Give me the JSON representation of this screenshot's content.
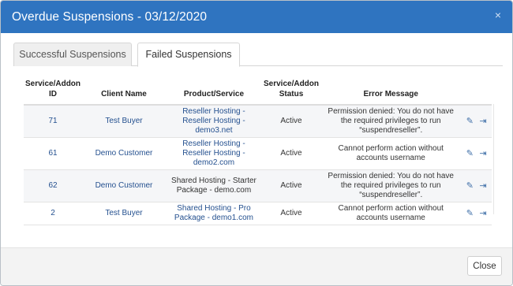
{
  "modal": {
    "title": "Overdue Suspensions - 03/12/2020",
    "close_icon": "×",
    "close_button_label": "Close"
  },
  "tabs": [
    {
      "label": "Successful Suspensions",
      "active": false
    },
    {
      "label": "Failed Suspensions",
      "active": true
    }
  ],
  "table": {
    "headers": {
      "id_line1": "Service/Addon",
      "id_line2": "ID",
      "client": "Client Name",
      "product": "Product/Service",
      "status_line1": "Service/Addon",
      "status_line2": "Status",
      "error": "Error Message"
    },
    "rows": [
      {
        "id": "71",
        "client": "Test Buyer",
        "product": "Reseller Hosting - Reseller Hosting - demo3.net",
        "status": "Active",
        "error": "Permission denied: You do not have the required privileges to run “suspendreseller”."
      },
      {
        "id": "61",
        "client": "Demo Customer",
        "product": "Reseller Hosting - Reseller Hosting - demo2.com",
        "status": "Active",
        "error": "Cannot perform action without accounts username"
      },
      {
        "id": "62",
        "client": "Demo Customer",
        "product": "Shared Hosting - Starter Package - demo.com",
        "status": "Active",
        "error": "Permission denied: You do not have the required privileges to run “suspendreseller”."
      },
      {
        "id": "2",
        "client": "Test Buyer",
        "product": "Shared Hosting - Pro Package - demo1.com",
        "status": "Active",
        "error": "Cannot perform action without accounts username"
      }
    ],
    "row_actions": [
      "edit-icon",
      "login-icon"
    ]
  },
  "colors": {
    "header_bg": "#2f74c0",
    "link": "#24508f",
    "footer_bg": "#f3f3f3"
  }
}
